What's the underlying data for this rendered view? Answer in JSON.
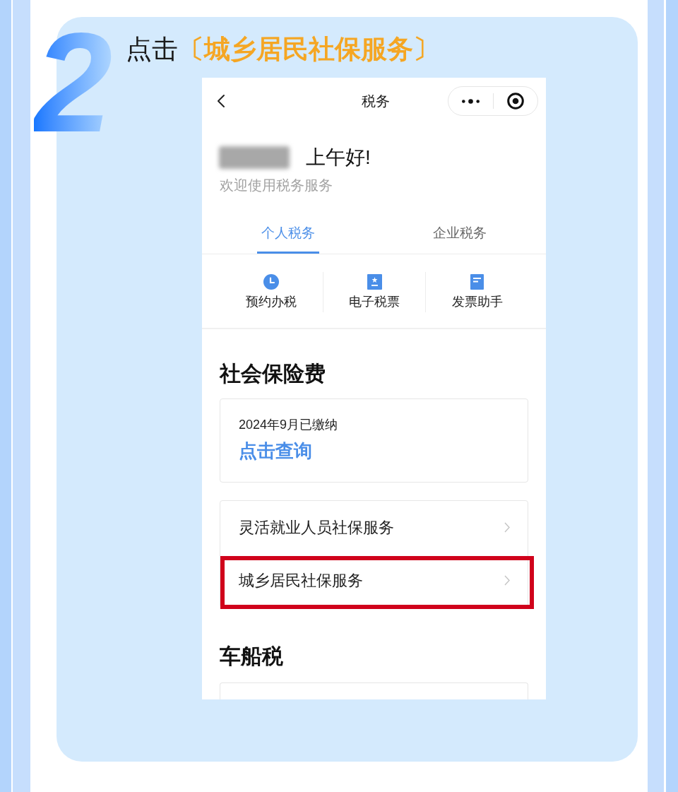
{
  "heading": {
    "step": "2",
    "title": "点击**〔城乡居民社保服务〕**"
  },
  "screen": {
    "nav_title": "税务",
    "greeting": "上午好!",
    "subtitle": "欢迎使用税务服务",
    "tabs": [
      {
        "label": "个人税务",
        "selected": true
      },
      {
        "label": "企业税务",
        "selected": false
      }
    ],
    "shortcuts": [
      {
        "label": "预约办税"
      },
      {
        "label": "电子税票"
      },
      {
        "label": "发票助手"
      }
    ],
    "social_insurance": {
      "title": "社会保险费",
      "status": "2024年9月已缴纳",
      "link": "点击查询",
      "services": [
        {
          "label": "灵活就业人员社保服务",
          "highlighted": false
        },
        {
          "label": "城乡居民社保服务",
          "highlighted": true
        }
      ]
    },
    "vehicle_tax": {
      "title": "车船税"
    }
  }
}
